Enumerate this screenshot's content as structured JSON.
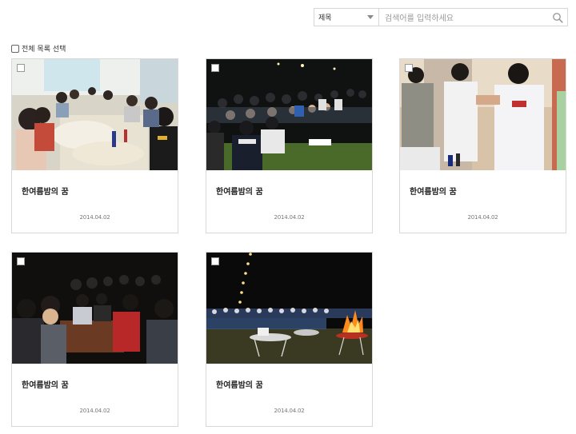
{
  "search": {
    "field_select": "제목",
    "placeholder": "검색어를 입력하세요"
  },
  "select_all_label": "전체 목록 선택",
  "gallery": [
    {
      "title": "한여름밤의 꿈",
      "date": "2014.04.02"
    },
    {
      "title": "한여름밤의 꿈",
      "date": "2014.04.02"
    },
    {
      "title": "한여름밤의 꿈",
      "date": "2014.04.02"
    },
    {
      "title": "한여름밤의 꿈",
      "date": "2014.04.02"
    },
    {
      "title": "한여름밤의 꿈",
      "date": "2014.04.02"
    }
  ],
  "icons": {
    "search": "search-icon",
    "dropdown": "chevron-down-icon"
  }
}
